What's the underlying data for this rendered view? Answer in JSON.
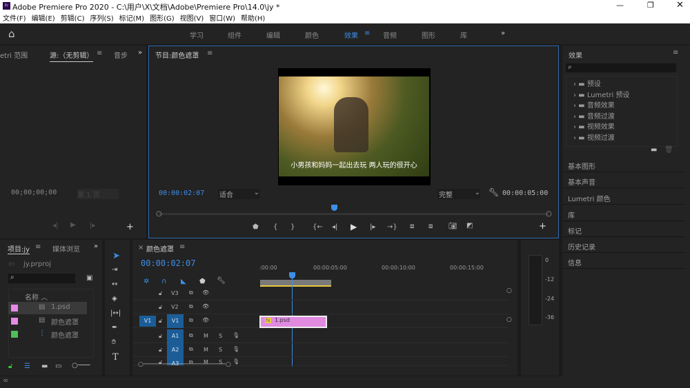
{
  "window": {
    "title": "Adobe Premiere Pro 2020 - C:\\用户\\X\\文档\\Adobe\\Premiere Pro\\14.0\\jy *",
    "app_icon": "Pr",
    "controls": [
      "minimize",
      "restore",
      "close"
    ]
  },
  "menu": [
    "文件(F)",
    "编辑(E)",
    "剪辑(C)",
    "序列(S)",
    "标记(M)",
    "图形(G)",
    "视图(V)",
    "窗口(W)",
    "帮助(H)"
  ],
  "workspaces": {
    "items": [
      "学习",
      "组件",
      "编辑",
      "颜色",
      "效果",
      "音频",
      "图形",
      "库"
    ],
    "active": "效果",
    "more": "»"
  },
  "source": {
    "tabs": [
      "etri 范围",
      "源:（无剪辑）",
      "音步"
    ],
    "active_tab": "源:（无剪辑）",
    "timecode": "00;00;00;00",
    "page": "第 1 页",
    "more": "»"
  },
  "program": {
    "title": "节目:颜色遮罩",
    "timecode": "00:00:02:07",
    "fit": "适合",
    "quality": "完整",
    "duration": "00:00:05:00",
    "subtitle": "小男孩和妈妈一起出去玩 两人玩的很开心",
    "playhead_fraction": 0.45
  },
  "effects": {
    "title": "效果",
    "tree": [
      "预设",
      "Lumetri 预设",
      "音频效果",
      "音频过渡",
      "视频效果",
      "视频过渡"
    ],
    "sections": [
      "基本图形",
      "基本声音",
      "Lumetri 颜色",
      "库",
      "标记",
      "历史记录",
      "信息"
    ]
  },
  "project": {
    "tabs": [
      "项目:jy",
      "媒体浏览"
    ],
    "file": "jy.prproj",
    "column": "名称",
    "items": [
      {
        "name": "1.psd",
        "color": "#e58ae5"
      },
      {
        "name": "颜色遮罩",
        "color": "#e58ae5"
      },
      {
        "name": "颜色遮罩",
        "color": "#4fbf5a"
      }
    ],
    "more": "»"
  },
  "timeline": {
    "title": "颜色遮罩",
    "timecode": "00:00:02:07",
    "ruler": [
      ":00:00",
      "00:00:05:00",
      "00:00:10:00",
      "00:00:15:00"
    ],
    "video_tracks": [
      "V3",
      "V2",
      "V1"
    ],
    "audio_tracks": [
      "A1",
      "A2",
      "A3"
    ],
    "source_patch": "V1",
    "mute": "M",
    "solo": "S",
    "clip": {
      "name": "1.psd",
      "fx": "fx",
      "color": "#e08ae0"
    },
    "playhead_seconds": 2.3
  },
  "meter": {
    "labels": [
      "0",
      "-12",
      "-24",
      "-36"
    ]
  },
  "colors": {
    "accent": "#3d8ee8",
    "clip": "#e08ae0"
  }
}
